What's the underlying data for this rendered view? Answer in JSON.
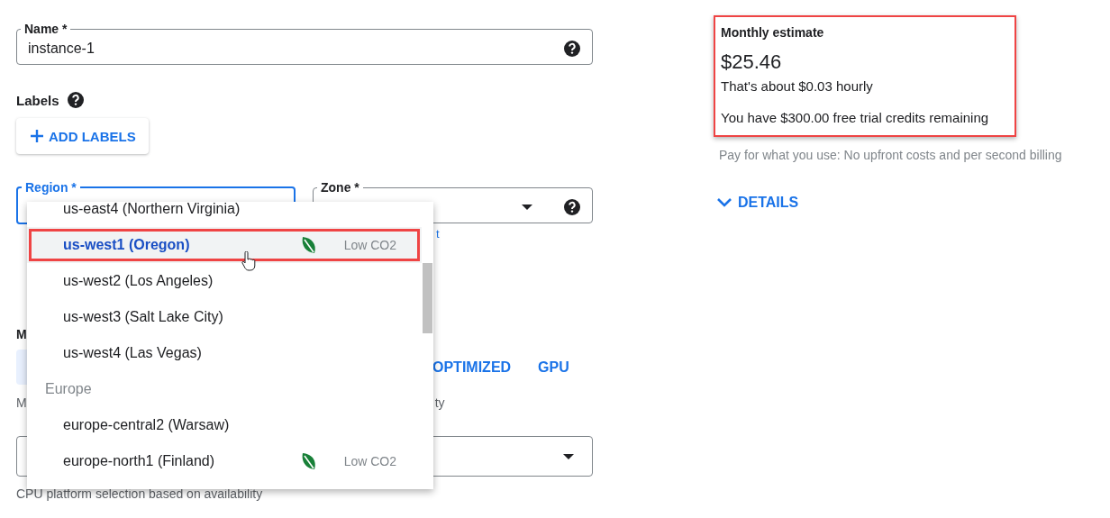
{
  "name_field": {
    "label": "Name *",
    "value": "instance-1"
  },
  "labels": {
    "label": "Labels",
    "button": "ADD LABELS"
  },
  "region_field": {
    "label": "Region *",
    "focused": true
  },
  "zone_field": {
    "label": "Zone *",
    "hint_fragment": "t"
  },
  "machine_section": {
    "label_fragment": "M",
    "tabs": [
      {
        "label": "OPTIMIZED",
        "selected": false
      },
      {
        "label": "GPU",
        "selected": false
      }
    ],
    "description_fragments": [
      "M",
      "ty"
    ]
  },
  "cpu_platform": {
    "hint": "CPU platform selection based on availability"
  },
  "region_dropdown": {
    "items": [
      {
        "kind": "option",
        "label": "us-east4 (Northern Virginia)",
        "selected": false,
        "highlighted": false
      },
      {
        "kind": "option",
        "label": "us-west1 (Oregon)",
        "selected": true,
        "highlighted": true,
        "badge": "Low CO2"
      },
      {
        "kind": "option",
        "label": "us-west2 (Los Angeles)",
        "selected": false,
        "highlighted": false
      },
      {
        "kind": "option",
        "label": "us-west3 (Salt Lake City)",
        "selected": false,
        "highlighted": false
      },
      {
        "kind": "option",
        "label": "us-west4 (Las Vegas)",
        "selected": false,
        "highlighted": false
      },
      {
        "kind": "group",
        "label": "Europe"
      },
      {
        "kind": "option",
        "label": "europe-central2 (Warsaw)",
        "selected": false,
        "highlighted": false
      },
      {
        "kind": "option",
        "label": "europe-north1 (Finland)",
        "selected": false,
        "highlighted": false,
        "badge": "Low CO2"
      }
    ]
  },
  "estimate": {
    "title": "Monthly estimate",
    "amount": "$25.46",
    "hourly": "That's about $0.03 hourly",
    "credits": "You have $300.00 free trial credits remaining",
    "highlighted": true
  },
  "billing_note": "Pay for what you use: No upfront costs and per second billing",
  "details_button": "DETAILS"
}
